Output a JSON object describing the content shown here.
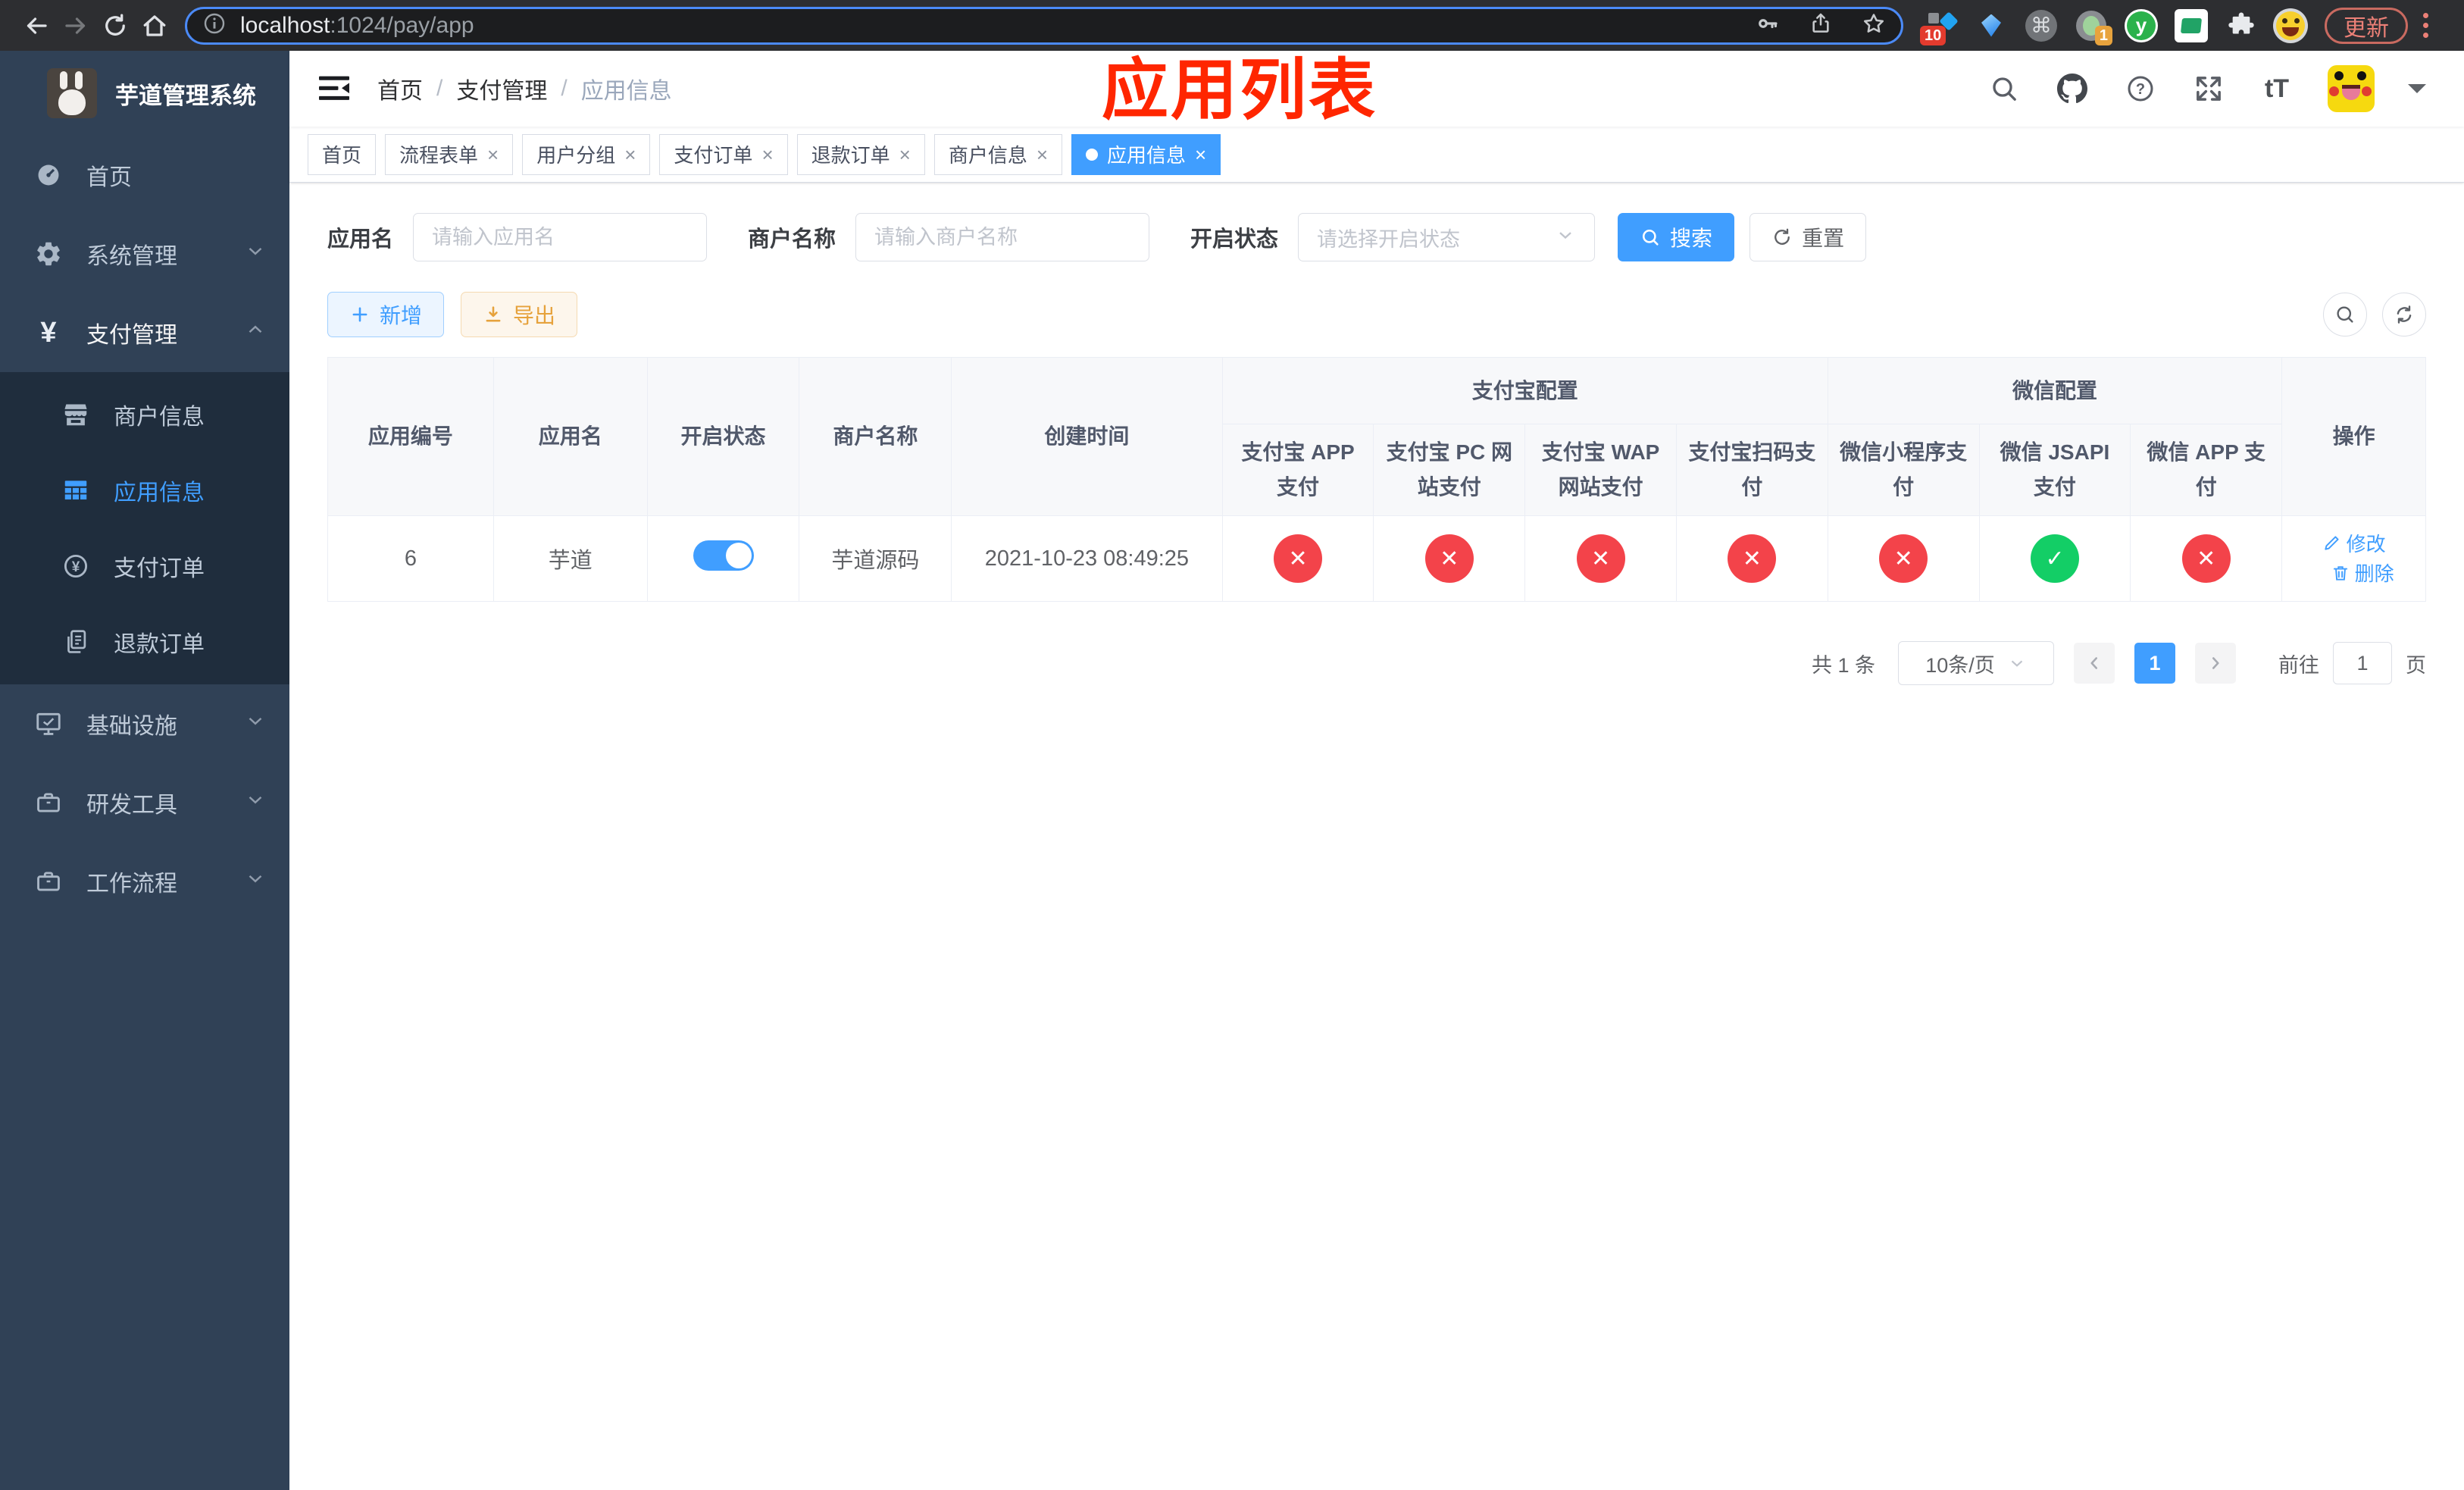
{
  "browser": {
    "url": {
      "host": "localhost",
      "path": ":1024/pay/app"
    },
    "update_button": "更新",
    "extension_badges": {
      "first": "10",
      "second": "1"
    },
    "ext_y_letter": "y"
  },
  "icons": {
    "close": "×",
    "command": "⌘",
    "font_size": "tT",
    "yen": "¥",
    "check": "✓",
    "cross": "✕",
    "question": "?",
    "info": "i",
    "slash": "/"
  },
  "sidebar": {
    "title": "芋道管理系统",
    "menu": [
      {
        "label": "首页"
      },
      {
        "label": "系统管理"
      },
      {
        "label": "支付管理"
      }
    ],
    "submenu": [
      {
        "label": "商户信息"
      },
      {
        "label": "应用信息"
      },
      {
        "label": "支付订单"
      },
      {
        "label": "退款订单"
      }
    ],
    "menu_bottom": [
      {
        "label": "基础设施"
      },
      {
        "label": "研发工具"
      },
      {
        "label": "工作流程"
      }
    ]
  },
  "header": {
    "breadcrumb": [
      "首页",
      "支付管理",
      "应用信息"
    ],
    "annotation_title": "应用列表"
  },
  "tabs": [
    {
      "label": "首页"
    },
    {
      "label": "流程表单"
    },
    {
      "label": "用户分组"
    },
    {
      "label": "支付订单"
    },
    {
      "label": "退款订单"
    },
    {
      "label": "商户信息"
    },
    {
      "label": "应用信息"
    }
  ],
  "filter": {
    "app_name_label": "应用名",
    "app_name_placeholder": "请输入应用名",
    "merchant_label": "商户名称",
    "merchant_placeholder": "请输入商户名称",
    "status_label": "开启状态",
    "status_placeholder": "请选择开启状态",
    "search_button": "搜索",
    "reset_button": "重置"
  },
  "toolbar": {
    "add_button": "新增",
    "export_button": "导出"
  },
  "table": {
    "headers": {
      "app_id": "应用编号",
      "app_name": "应用名",
      "status": "开启状态",
      "merchant": "商户名称",
      "created": "创建时间",
      "alipay_group": "支付宝配置",
      "wechat_group": "微信配置",
      "actions": "操作",
      "alipay_app": "支付宝 APP 支付",
      "alipay_pc": "支付宝 PC 网站支付",
      "alipay_wap": "支付宝 WAP 网站支付",
      "alipay_scan": "支付宝扫码支付",
      "wechat_mini": "微信小程序支付",
      "wechat_jsapi": "微信 JSAPI 支付",
      "wechat_app": "微信 APP 支付"
    },
    "row": {
      "app_id": "6",
      "app_name": "芋道",
      "enabled": true,
      "merchant": "芋道源码",
      "created": "2021-10-23 08:49:25",
      "alipay_app": false,
      "alipay_pc": false,
      "alipay_wap": false,
      "alipay_scan": false,
      "wechat_mini": false,
      "wechat_jsapi": true,
      "wechat_app": false,
      "edit_button": "修改",
      "delete_button": "删除"
    }
  },
  "pagination": {
    "total": "共 1 条",
    "page_size": "10条/页",
    "current_page": "1",
    "goto_label": "前往",
    "goto_value": "1",
    "page_suffix": "页"
  },
  "colors": {
    "accent": "#409eff",
    "success": "#13ce66",
    "danger": "#f3434a",
    "warning": "#e6a23c",
    "sidebar_bg": "#304156",
    "submenu_bg": "#1f2d3d",
    "annotation_red": "#ff2600"
  }
}
